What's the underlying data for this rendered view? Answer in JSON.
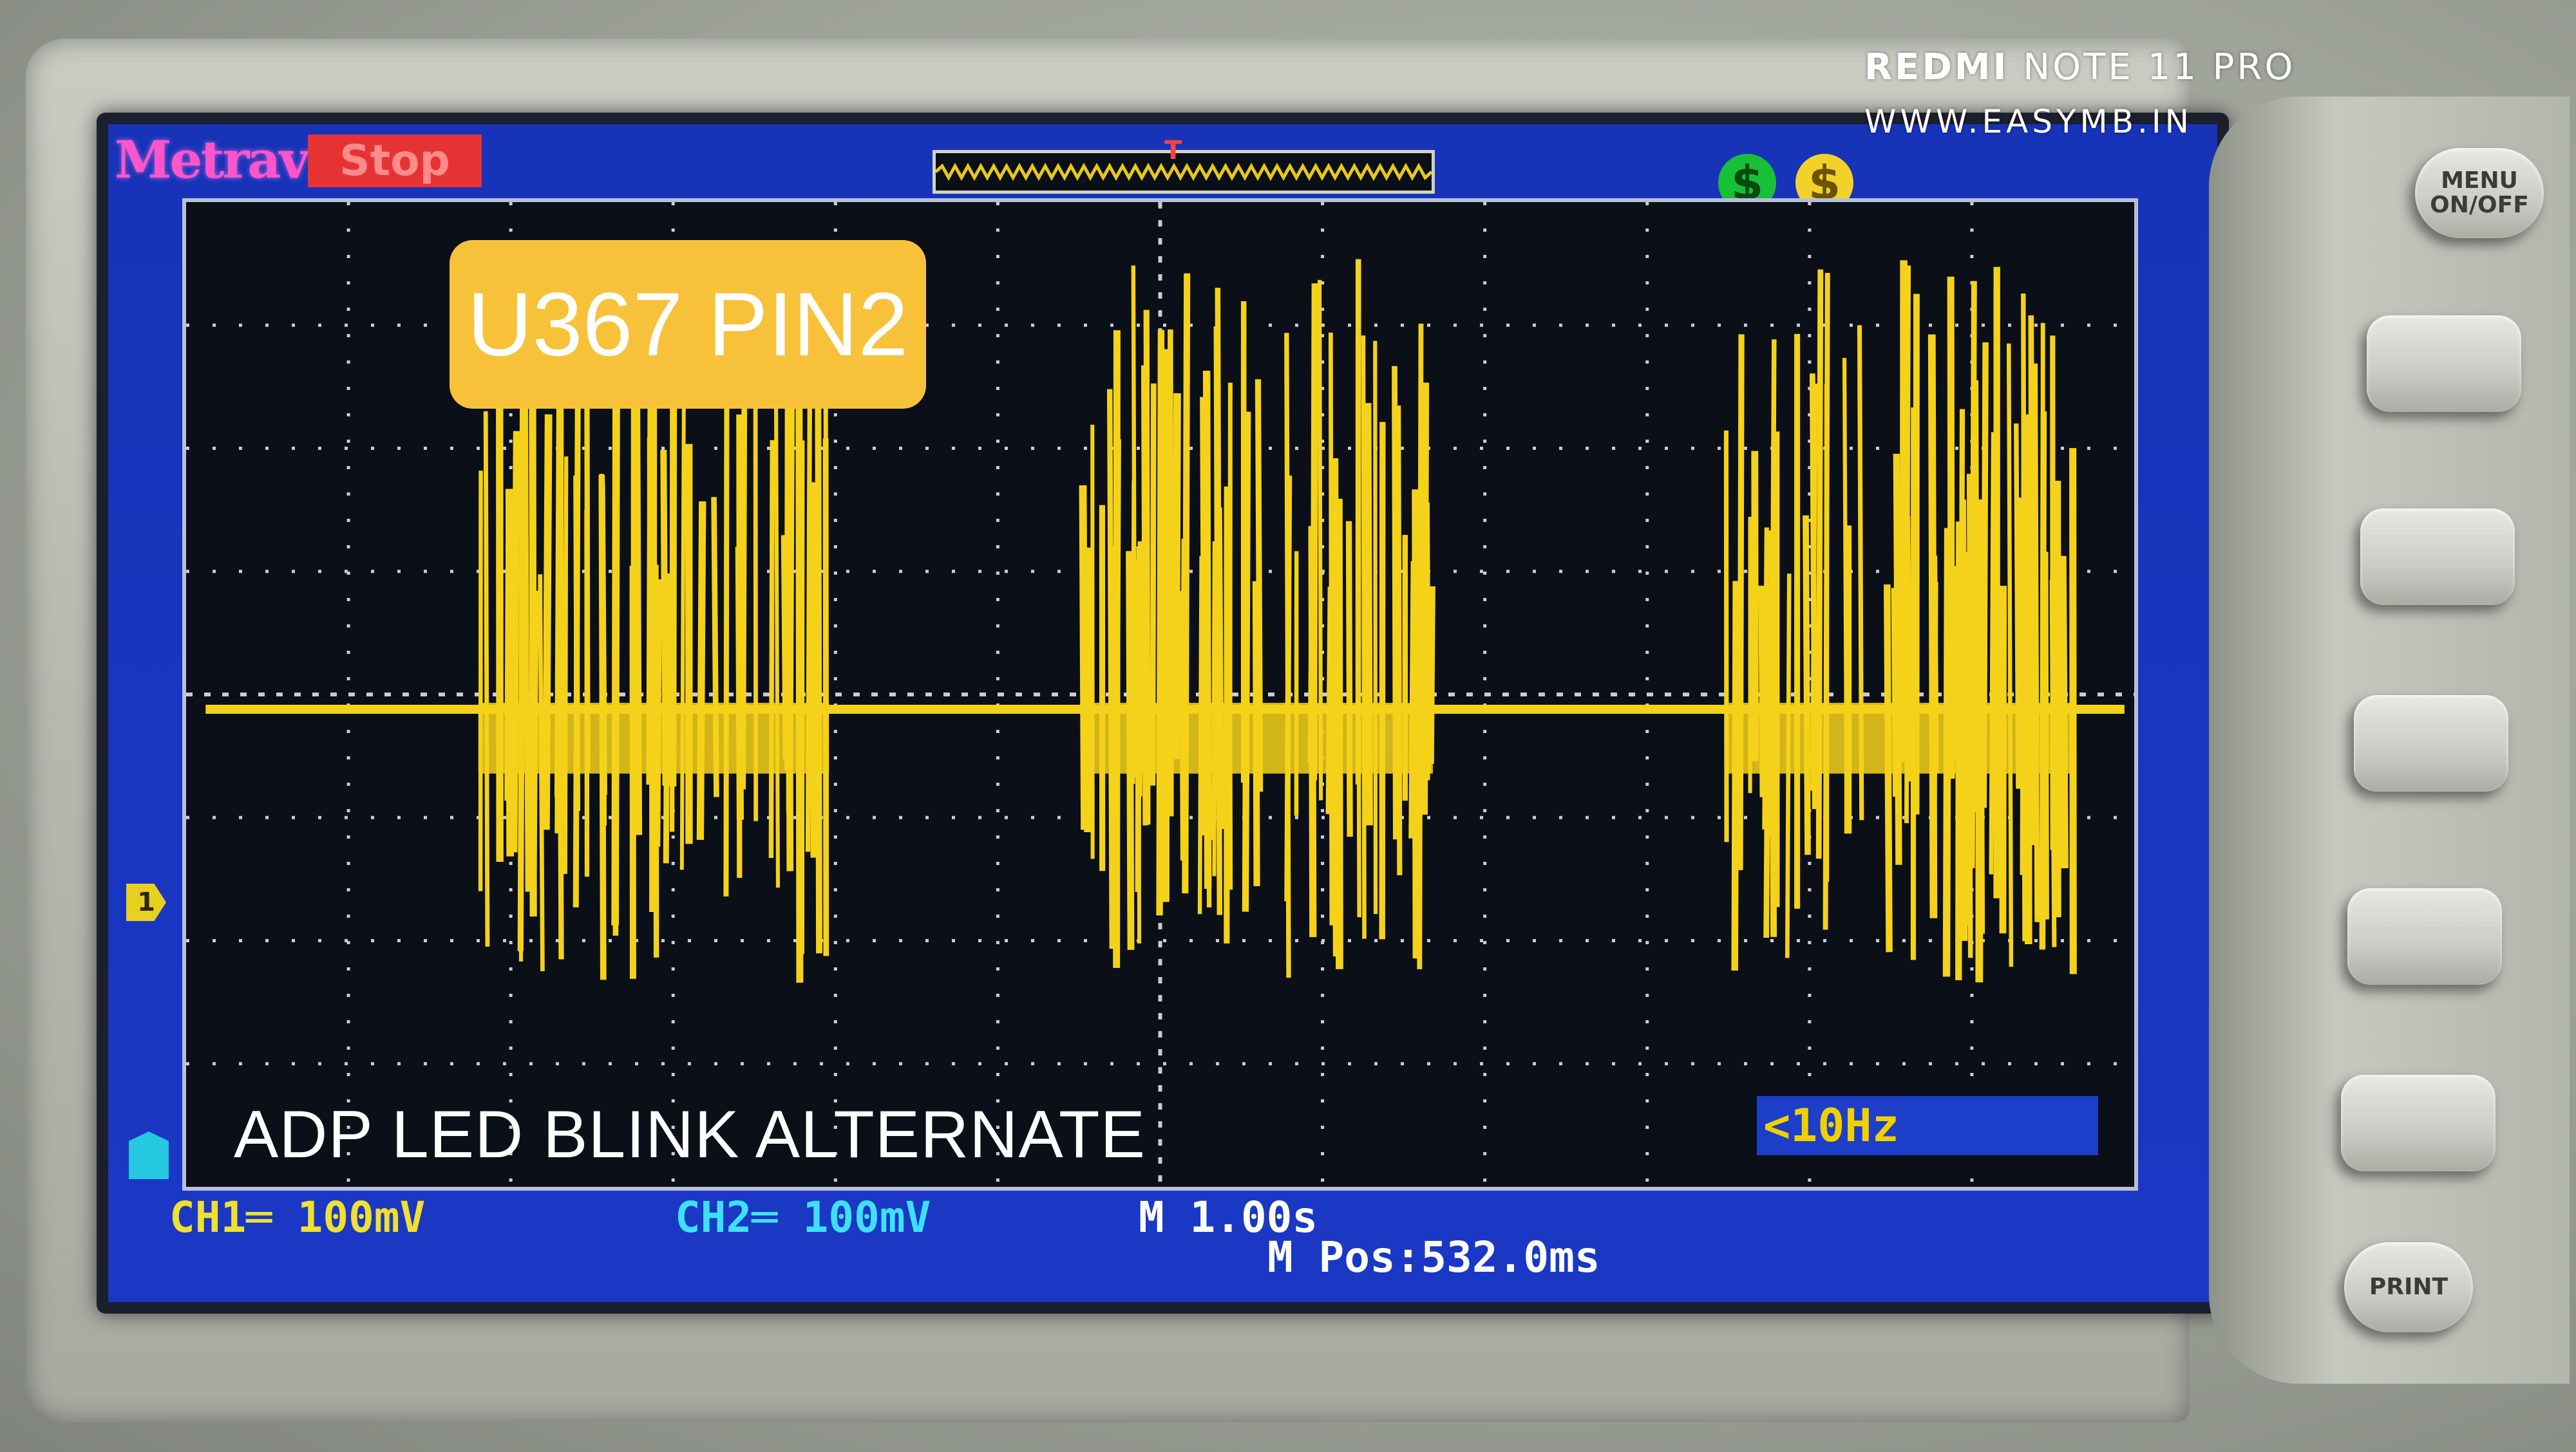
{
  "watermark": {
    "brand": "REDMI",
    "model": "NOTE 11 PRO",
    "site": "WWW.EASYMB.IN"
  },
  "scope": {
    "brand": "Metravi",
    "run_state": "Stop",
    "label": "U367 PIN2",
    "caption": "ADP LED BLINK ALTERNATE",
    "ch1_marker": "1",
    "ch2_marker": "",
    "trigger_freq": "<10Hz",
    "ch1_scale": "CH1═ 100mV",
    "ch2_scale": "CH2═ 100mV",
    "timebase": "M 1.00s",
    "m_pos": "M Pos:532.0ms",
    "trace_color": "#f5d21a",
    "grid_color": "#c8ccd8"
  },
  "buttons": {
    "menu": "MENU ON/OFF",
    "f1": "",
    "f2": "",
    "f3": "",
    "f4": "",
    "f5": "",
    "print": "PRINT"
  },
  "bursts": [
    {
      "start": 0.15,
      "end": 0.33
    },
    {
      "start": 0.46,
      "end": 0.64
    },
    {
      "start": 0.79,
      "end": 0.97
    }
  ]
}
